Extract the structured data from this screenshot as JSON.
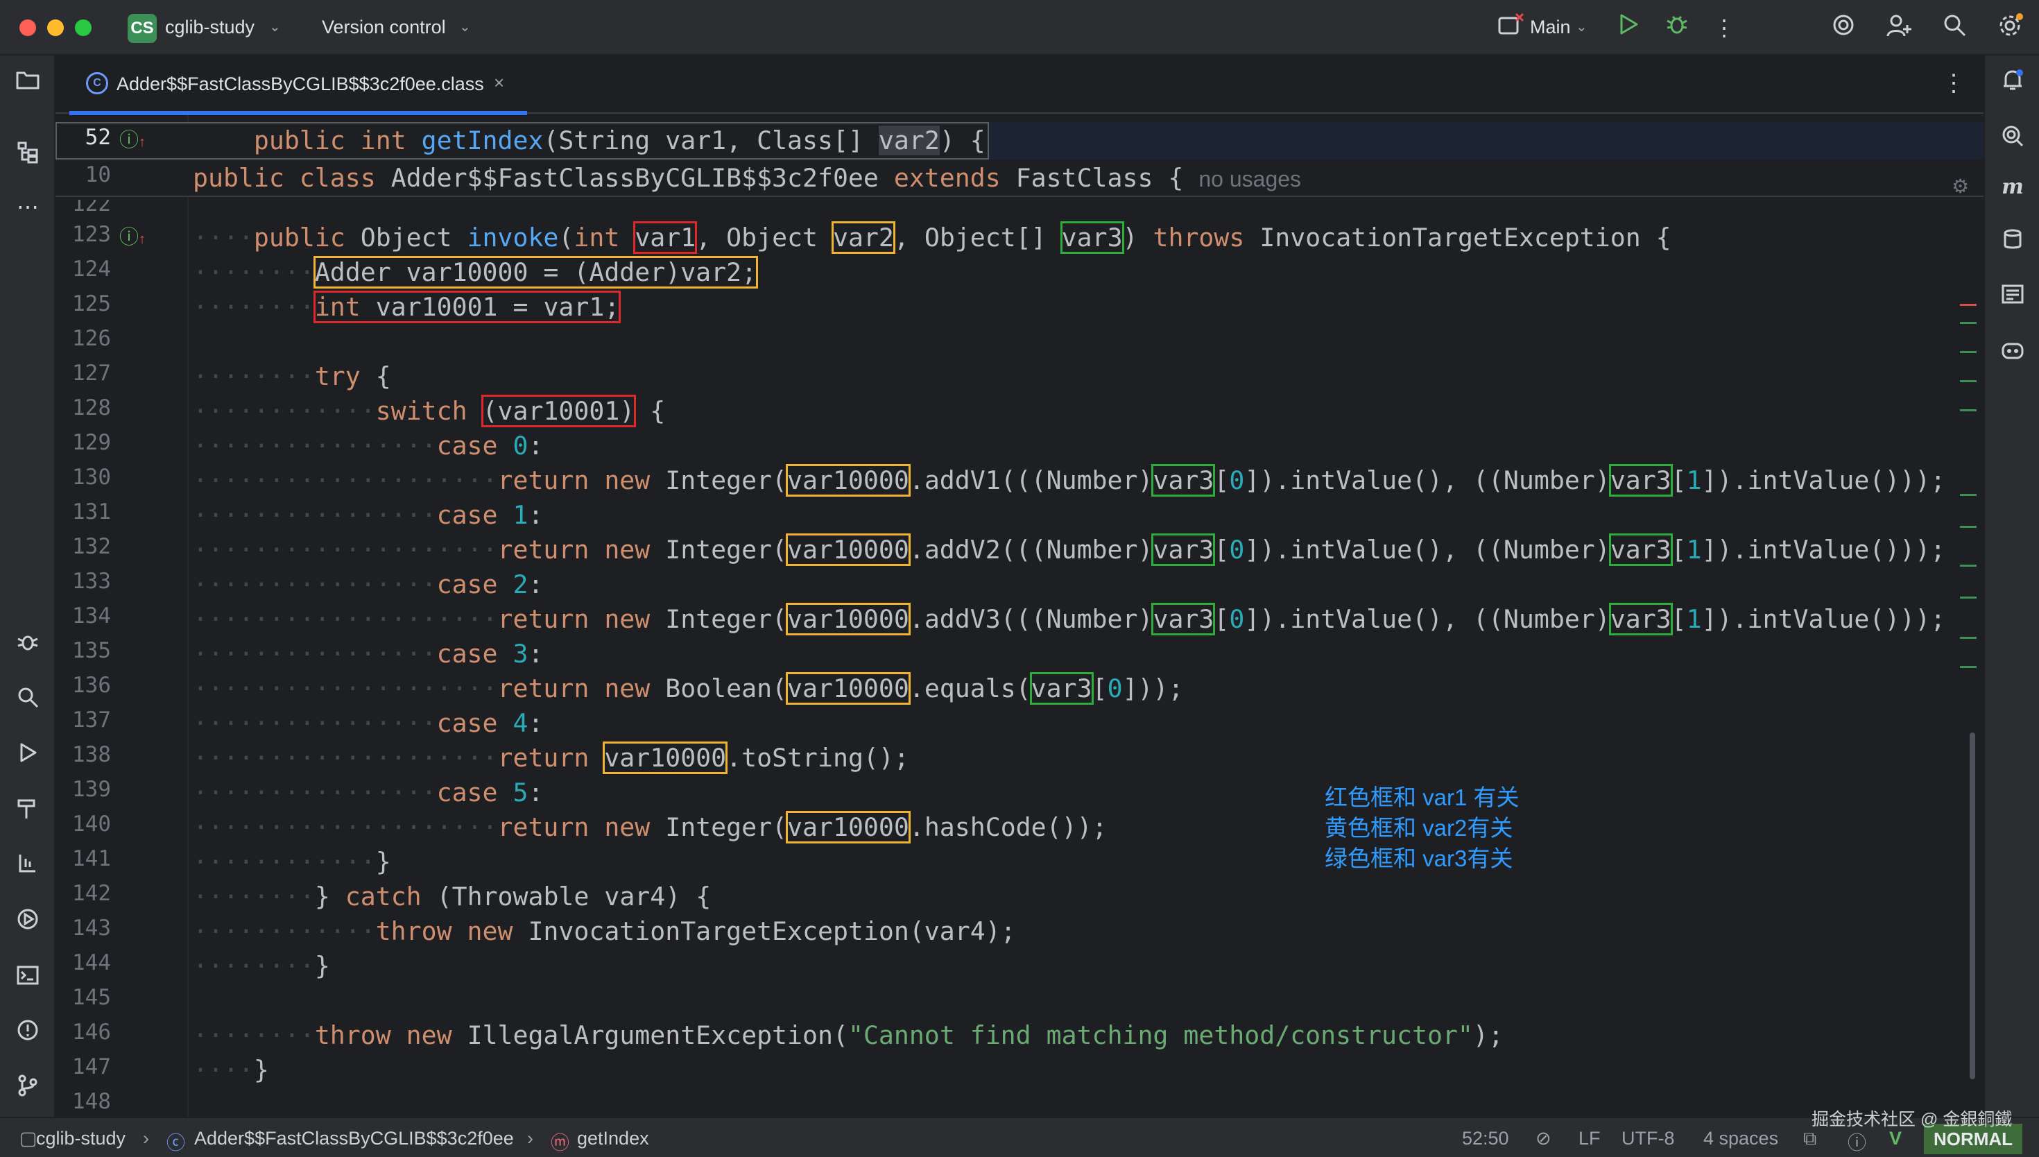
{
  "titlebar": {
    "project_badge": "CS",
    "project_name": "cglib-study",
    "vcs_label": "Version control",
    "run_config": "Main",
    "icons": [
      "run-icon",
      "debug-icon",
      "more-icon",
      "ai-icon",
      "add-user-icon",
      "search-icon",
      "settings-icon"
    ]
  },
  "tab": {
    "label": "Adder$$FastClassByCGLIB$$3c2f0ee.class",
    "icon": "C"
  },
  "sticky": {
    "line1_number": "52",
    "line1_code": "public int getIndex(String var1, Class[] var2) {",
    "line2_number": "10",
    "line2_code": "public class Adder$$FastClassByCGLIB$$3c2f0ee extends FastClass {",
    "no_usages_hint": "no usages"
  },
  "code": {
    "line_numbers": [
      "122",
      "123",
      "124",
      "125",
      "126",
      "127",
      "128",
      "129",
      "130",
      "131",
      "132",
      "133",
      "134",
      "135",
      "136",
      "137",
      "138",
      "139",
      "140",
      "141",
      "142",
      "143",
      "144",
      "145",
      "146",
      "147",
      "148"
    ]
  },
  "annotation": {
    "line1": "红色框和 var1 有关",
    "line2": "黄色框和 var2有关",
    "line3": "绿色框和 var3有关"
  },
  "statusbar": {
    "project": "cglib-study",
    "class": "Adder$$FastClassByCGLIB$$3c2f0ee",
    "method": "getIndex",
    "position": "52:50",
    "line_sep": "LF",
    "encoding": "UTF-8",
    "indent": "4 spaces",
    "mode": "NORMAL"
  },
  "watermark": "掘金技术社区 @ 金銀銅鐵",
  "colors": {
    "red_box": "#e0282b",
    "yellow_box": "#f0b431",
    "green_box": "#2dad3c",
    "annotation": "#2f9bff",
    "accent": "#3574f0"
  }
}
